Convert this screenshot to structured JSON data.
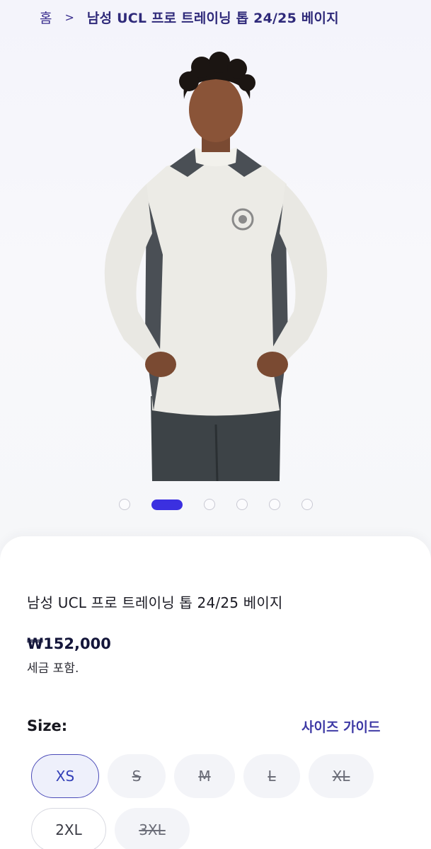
{
  "breadcrumb": {
    "home": "홈",
    "separator": ">",
    "current": "남성 UCL 프로 트레이닝 톱 24/25 베이지"
  },
  "carousel": {
    "dot_count": 6,
    "active_index": 1
  },
  "product": {
    "title": "남성 UCL 프로 트레이닝 톱 24/25 베이지",
    "price": "₩152,000",
    "tax_note": "세금 포함."
  },
  "size": {
    "label": "Size:",
    "guide_label": "사이즈 가이드",
    "options": [
      {
        "label": "XS",
        "state": "selected"
      },
      {
        "label": "S",
        "state": "soldout"
      },
      {
        "label": "M",
        "state": "soldout"
      },
      {
        "label": "L",
        "state": "soldout"
      },
      {
        "label": "XL",
        "state": "soldout"
      },
      {
        "label": "2XL",
        "state": "available"
      },
      {
        "label": "3XL",
        "state": "soldout"
      }
    ]
  },
  "colors": {
    "accent": "#3b30e0",
    "breadcrumb": "#3b2f8f",
    "size_guide": "#3e3aa5",
    "price": "#14163a"
  }
}
